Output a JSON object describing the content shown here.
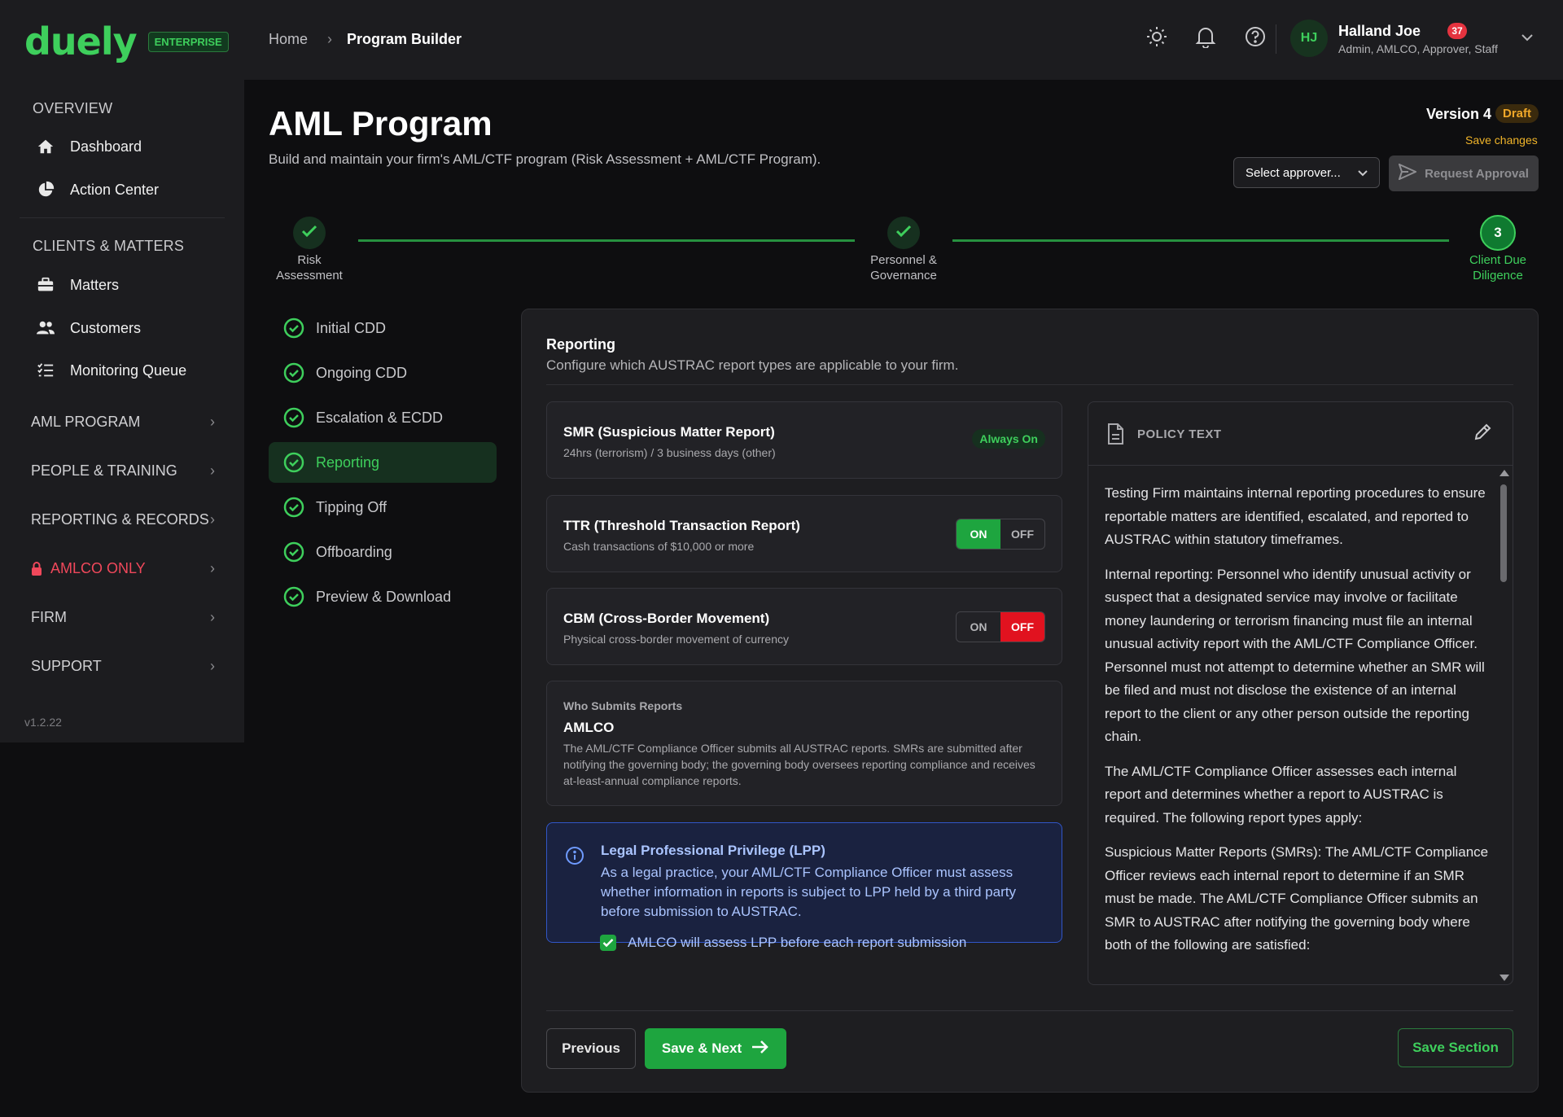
{
  "brand": {
    "logo": "duely",
    "badge": "ENTERPRISE"
  },
  "sidebar": {
    "overview_title": "OVERVIEW",
    "overview_items": [
      {
        "label": "Dashboard",
        "icon": "home-icon"
      },
      {
        "label": "Action Center",
        "icon": "pie-chart-icon"
      }
    ],
    "clients_title": "CLIENTS & MATTERS",
    "clients_items": [
      {
        "label": "Matters",
        "icon": "briefcase-icon"
      },
      {
        "label": "Customers",
        "icon": "users-icon"
      },
      {
        "label": "Monitoring Queue",
        "icon": "list-check-icon"
      }
    ],
    "groups": [
      {
        "label": "AML PROGRAM"
      },
      {
        "label": "PEOPLE & TRAINING"
      },
      {
        "label": "REPORTING & RECORDS"
      },
      {
        "label": "AMLCO ONLY",
        "icon": "lock-icon",
        "color": "#f0485b"
      },
      {
        "label": "FIRM"
      },
      {
        "label": "SUPPORT"
      }
    ],
    "version": "v1.2.22"
  },
  "topbar": {
    "breadcrumb": {
      "home": "Home",
      "current": "Program Builder"
    },
    "notification_count": "37",
    "user": {
      "initials": "HJ",
      "name": "Halland Joe",
      "roles": "Admin, AMLCO, Approver, Staff"
    }
  },
  "header": {
    "title": "AML Program",
    "subtitle": "Build and maintain your firm's AML/CTF program (Risk Assessment + AML/CTF Program).",
    "version_label": "Version 4",
    "status_badge": "Draft",
    "save_changes": "Save changes",
    "approver_placeholder": "Select approver...",
    "request_approval": "Request Approval"
  },
  "stepper": [
    {
      "label_line1": "Risk",
      "label_line2": "Assessment",
      "state": "complete"
    },
    {
      "label_line1": "Personnel &",
      "label_line2": "Governance",
      "state": "complete"
    },
    {
      "number": "3",
      "label_line1": "Client Due",
      "label_line2": "Diligence",
      "state": "active"
    }
  ],
  "sections": [
    {
      "label": "Initial CDD"
    },
    {
      "label": "Ongoing CDD"
    },
    {
      "label": "Escalation & ECDD"
    },
    {
      "label": "Reporting",
      "active": true
    },
    {
      "label": "Tipping Off"
    },
    {
      "label": "Offboarding"
    },
    {
      "label": "Preview & Download"
    }
  ],
  "main": {
    "title": "Reporting",
    "subtitle": "Configure which AUSTRAC report types are applicable to your firm.",
    "report_types": [
      {
        "title": "SMR (Suspicious Matter Report)",
        "desc": "24hrs (terrorism) / 3 business days (other)",
        "badge": "Always On"
      },
      {
        "title": "TTR (Threshold Transaction Report)",
        "desc": "Cash transactions of $10,000 or more",
        "on_label": "ON",
        "off_label": "OFF",
        "value": "ON"
      },
      {
        "title": "CBM (Cross-Border Movement)",
        "desc": "Physical cross-border movement of currency",
        "on_label": "ON",
        "off_label": "OFF",
        "value": "OFF"
      }
    ],
    "who_submits": {
      "label": "Who Submits Reports",
      "value": "AMLCO",
      "desc": "The AML/CTF Compliance Officer submits all AUSTRAC reports. SMRs are submitted after notifying the governing body; the governing body oversees reporting compliance and receives at-least-annual compliance reports."
    },
    "lpp": {
      "title": "Legal Professional Privilege (LPP)",
      "desc": "As a legal practice, your AML/CTF Compliance Officer must assess whether information in reports is subject to LPP held by a third party before submission to AUSTRAC.",
      "checkbox_label": "AMLCO will assess LPP before each report submission",
      "checked": true
    },
    "policy": {
      "label": "POLICY TEXT",
      "paragraphs": [
        "Testing Firm maintains internal reporting procedures to ensure reportable matters are identified, escalated, and reported to AUSTRAC within statutory timeframes.",
        "Internal reporting: Personnel who identify unusual activity or suspect that a designated service may involve or facilitate money laundering or terrorism financing must file an internal unusual activity report with the AML/CTF Compliance Officer. Personnel must not attempt to determine whether an SMR will be filed and must not disclose the existence of an internal report to the client or any other person outside the reporting chain.",
        "The AML/CTF Compliance Officer assesses each internal report and determines whether a report to AUSTRAC is required. The following report types apply:",
        "Suspicious Matter Reports (SMRs): The AML/CTF Compliance Officer reviews each internal report to determine if an SMR must be made. The AML/CTF Compliance Officer submits an SMR to AUSTRAC after notifying the governing body where both of the following are satisfied:"
      ]
    },
    "buttons": {
      "previous": "Previous",
      "next": "Save & Next",
      "save_section": "Save Section"
    }
  },
  "colors": {
    "accent": "#3ecf5c",
    "danger": "#e1121f",
    "warning": "#f0a829",
    "info": "#aac4ff"
  }
}
